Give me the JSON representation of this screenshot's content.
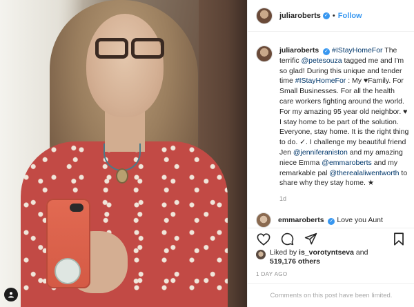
{
  "post": {
    "username": "juliaroberts",
    "follow_label": "Follow",
    "separator": "•"
  },
  "caption": {
    "username": "juliaroberts",
    "segments": [
      {
        "t": "#IStayHomeFor",
        "link": true
      },
      {
        "t": " The terrific ",
        "link": false
      },
      {
        "t": "@petesouza",
        "link": true
      },
      {
        "t": " tagged me and I'm so glad! During this unique and tender time ",
        "link": false
      },
      {
        "t": "#IStayHomeFor",
        "link": true
      },
      {
        "t": " : My ♥Family. For Small Businesses. For all the health care workers fighting around the world. For my amazing 95 year old neighbor. ♥ I stay home to be part of the solution. Everyone, stay home. It is the right thing to do. ✓. I challenge my beautiful friend Jen ",
        "link": false
      },
      {
        "t": "@jenniferaniston",
        "link": true
      },
      {
        "t": " and my amazing niece Emma ",
        "link": false
      },
      {
        "t": "@emmaroberts",
        "link": true
      },
      {
        "t": " and my remarkable pal ",
        "link": false
      },
      {
        "t": "@therealaliwentworth",
        "link": true
      },
      {
        "t": " to share why they stay home. ★",
        "link": false
      }
    ],
    "time": "1d"
  },
  "comment": {
    "username": "emmaroberts",
    "text": "Love you Aunt"
  },
  "likes": {
    "prefix": "Liked by ",
    "user": "is_vorotyntseva",
    "and": " and",
    "count": "519,176 others"
  },
  "date": "1 DAY AGO",
  "comments_limited": "Comments on this post have been limited.",
  "icons": {
    "like": "heart-icon",
    "comment": "comment-bubble-icon",
    "share": "paper-plane-icon",
    "save": "bookmark-icon",
    "verified": "verified-badge-icon",
    "user_tag": "person-tag-icon"
  },
  "colors": {
    "link": "#00376b",
    "follow": "#3897f0",
    "muted": "#8e8e8e",
    "border": "#efefef"
  }
}
